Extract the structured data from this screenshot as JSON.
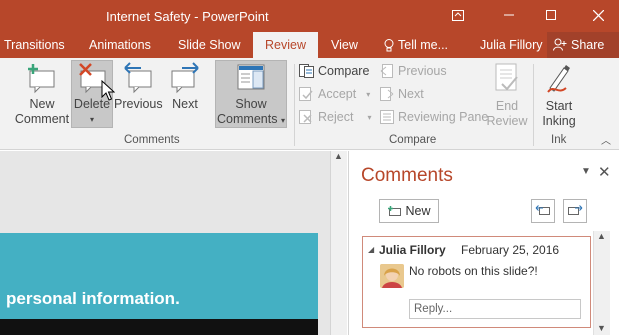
{
  "window": {
    "title": "Internet Safety - PowerPoint"
  },
  "tabs": [
    {
      "label": "Transitions"
    },
    {
      "label": "Animations"
    },
    {
      "label": "Slide Show"
    },
    {
      "label": "Review"
    },
    {
      "label": "View"
    },
    {
      "label": "Tell me..."
    }
  ],
  "user": "Julia Fillory",
  "share_label": "Share",
  "ribbon": {
    "comments_group": {
      "label": "Comments",
      "new_comment": [
        "New",
        "Comment"
      ],
      "delete": "Delete",
      "previous": "Previous",
      "next": "Next",
      "show_comments": [
        "Show",
        "Comments"
      ]
    },
    "compare_group": {
      "label": "Compare",
      "compare": "Compare",
      "accept": "Accept",
      "reject": "Reject",
      "previous": "Previous",
      "next": "Next",
      "reviewing_pane": "Reviewing Pane",
      "end_review": [
        "End",
        "Review"
      ]
    },
    "ink_group": {
      "label": "Ink",
      "start_inking": [
        "Start",
        "Inking"
      ]
    }
  },
  "slide": {
    "text": "personal information."
  },
  "comments_pane": {
    "title": "Comments",
    "new_label": "New",
    "comment": {
      "author": "Julia Fillory",
      "date": "February 25, 2016",
      "text": "No robots on this slide?!",
      "reply_placeholder": "Reply..."
    }
  },
  "colors": {
    "accent": "#b7472a",
    "slide_teal": "#44b0c3"
  }
}
